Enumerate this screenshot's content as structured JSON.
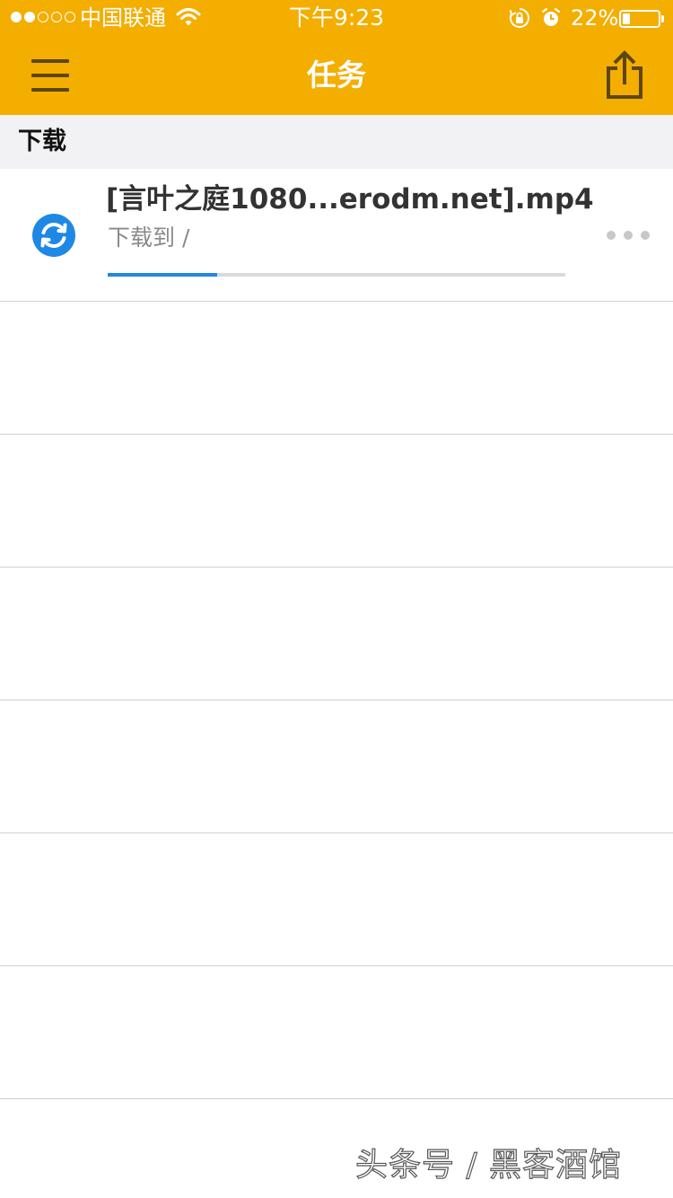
{
  "status_bar": {
    "carrier": "中国联通",
    "time": "下午9:23",
    "battery_percent": "22%",
    "battery_level": 0.22,
    "signal_bars_filled": 2,
    "signal_bars_total": 5,
    "icons": [
      "wifi-icon",
      "orientation-lock-icon",
      "alarm-icon",
      "battery-icon"
    ]
  },
  "nav": {
    "title": "任务",
    "left_icon": "hamburger-menu-icon",
    "right_icon": "share-icon",
    "background_color": "#F4AE00"
  },
  "section": {
    "title": "下载"
  },
  "tasks": [
    {
      "name": "[言叶之庭1080...erodm.net].mp4",
      "subtitle": "下载到 /",
      "progress": 0.24,
      "status_icon": "refresh-icon",
      "accent_color": "#1E88E5"
    }
  ],
  "watermark": "头条号 / 黑客酒馆"
}
